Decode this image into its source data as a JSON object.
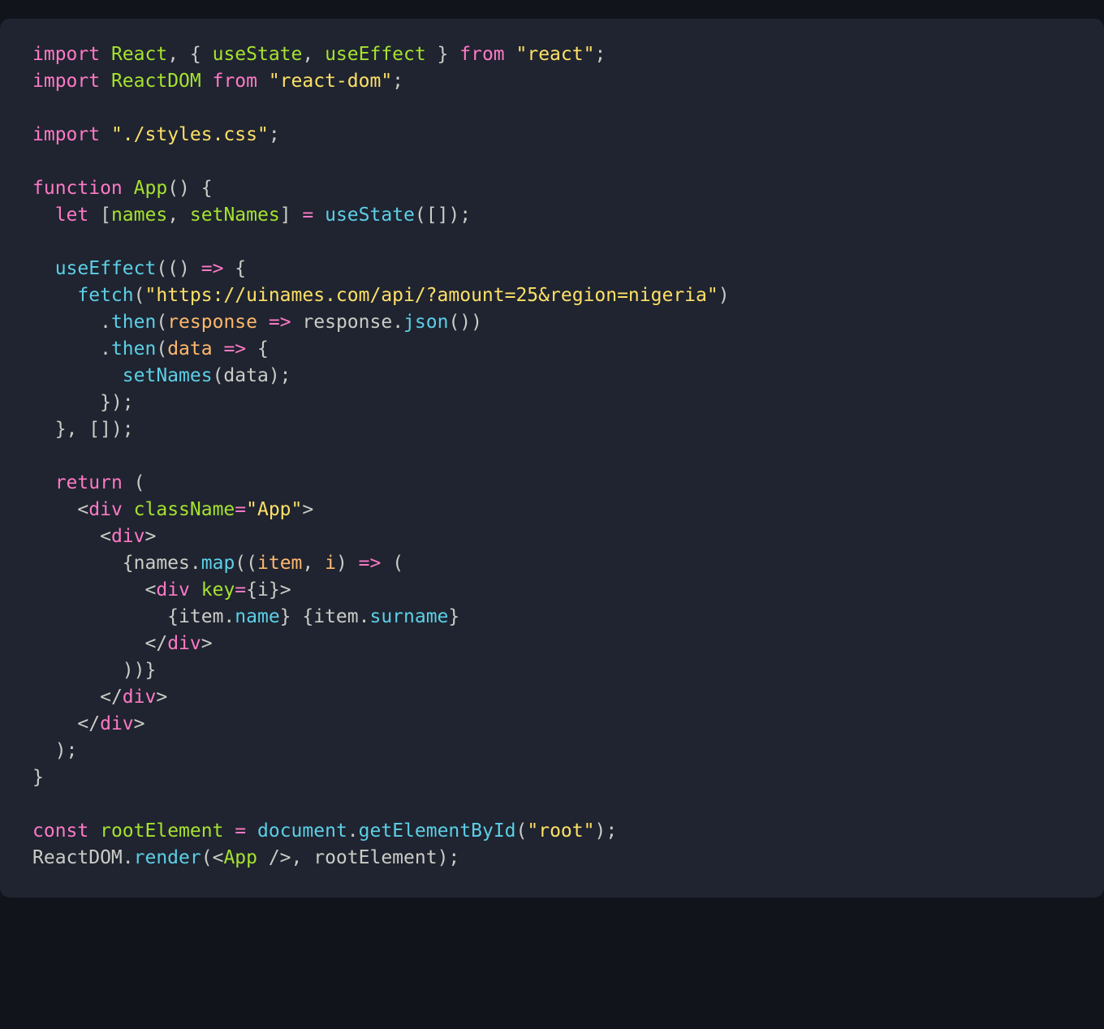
{
  "code": {
    "lines": [
      {
        "indent": 0,
        "tokens": [
          [
            "kw",
            "import"
          ],
          [
            "p",
            " "
          ],
          [
            "def",
            "React"
          ],
          [
            "p",
            ", { "
          ],
          [
            "def",
            "useState"
          ],
          [
            "p",
            ", "
          ],
          [
            "def",
            "useEffect"
          ],
          [
            "p",
            " } "
          ],
          [
            "kw",
            "from"
          ],
          [
            "p",
            " "
          ],
          [
            "str",
            "\"react\""
          ],
          [
            "p",
            ";"
          ]
        ]
      },
      {
        "indent": 0,
        "tokens": [
          [
            "kw",
            "import"
          ],
          [
            "p",
            " "
          ],
          [
            "def",
            "ReactDOM"
          ],
          [
            "p",
            " "
          ],
          [
            "kw",
            "from"
          ],
          [
            "p",
            " "
          ],
          [
            "str",
            "\"react-dom\""
          ],
          [
            "p",
            ";"
          ]
        ]
      },
      {
        "indent": 0,
        "tokens": []
      },
      {
        "indent": 0,
        "tokens": [
          [
            "kw",
            "import"
          ],
          [
            "p",
            " "
          ],
          [
            "str",
            "\"./styles.css\""
          ],
          [
            "p",
            ";"
          ]
        ]
      },
      {
        "indent": 0,
        "tokens": []
      },
      {
        "indent": 0,
        "tokens": [
          [
            "kw",
            "function"
          ],
          [
            "p",
            " "
          ],
          [
            "def",
            "App"
          ],
          [
            "p",
            "() {"
          ]
        ]
      },
      {
        "indent": 1,
        "tokens": [
          [
            "kw",
            "let"
          ],
          [
            "p",
            " ["
          ],
          [
            "def",
            "names"
          ],
          [
            "p",
            ", "
          ],
          [
            "def",
            "setNames"
          ],
          [
            "p",
            "] "
          ],
          [
            "op",
            "="
          ],
          [
            "p",
            " "
          ],
          [
            "fn",
            "useState"
          ],
          [
            "p",
            "([]);"
          ]
        ]
      },
      {
        "indent": 0,
        "tokens": []
      },
      {
        "indent": 1,
        "tokens": [
          [
            "fn",
            "useEffect"
          ],
          [
            "p",
            "(() "
          ],
          [
            "op",
            "=>"
          ],
          [
            "p",
            " {"
          ]
        ]
      },
      {
        "indent": 2,
        "tokens": [
          [
            "fn",
            "fetch"
          ],
          [
            "p",
            "("
          ],
          [
            "str",
            "\"https://uinames.com/api/?amount=25&region=nigeria\""
          ],
          [
            "p",
            ")"
          ]
        ]
      },
      {
        "indent": 3,
        "tokens": [
          [
            "p",
            "."
          ],
          [
            "fn",
            "then"
          ],
          [
            "p",
            "("
          ],
          [
            "par",
            "response"
          ],
          [
            "p",
            " "
          ],
          [
            "op",
            "=>"
          ],
          [
            "p",
            " "
          ],
          [
            "id",
            "response"
          ],
          [
            "p",
            "."
          ],
          [
            "fn",
            "json"
          ],
          [
            "p",
            "())"
          ]
        ]
      },
      {
        "indent": 3,
        "tokens": [
          [
            "p",
            "."
          ],
          [
            "fn",
            "then"
          ],
          [
            "p",
            "("
          ],
          [
            "par",
            "data"
          ],
          [
            "p",
            " "
          ],
          [
            "op",
            "=>"
          ],
          [
            "p",
            " {"
          ]
        ]
      },
      {
        "indent": 4,
        "tokens": [
          [
            "fn",
            "setNames"
          ],
          [
            "p",
            "("
          ],
          [
            "id",
            "data"
          ],
          [
            "p",
            ");"
          ]
        ]
      },
      {
        "indent": 3,
        "tokens": [
          [
            "p",
            "});"
          ]
        ]
      },
      {
        "indent": 1,
        "tokens": [
          [
            "p",
            "}, []);"
          ]
        ]
      },
      {
        "indent": 0,
        "tokens": []
      },
      {
        "indent": 1,
        "tokens": [
          [
            "kw",
            "return"
          ],
          [
            "p",
            " ("
          ]
        ]
      },
      {
        "indent": 2,
        "tokens": [
          [
            "p",
            "<"
          ],
          [
            "tag",
            "div"
          ],
          [
            "p",
            " "
          ],
          [
            "attr",
            "className"
          ],
          [
            "op",
            "="
          ],
          [
            "str",
            "\"App\""
          ],
          [
            "p",
            ">"
          ]
        ]
      },
      {
        "indent": 3,
        "tokens": [
          [
            "p",
            "<"
          ],
          [
            "tag",
            "div"
          ],
          [
            "p",
            ">"
          ]
        ]
      },
      {
        "indent": 4,
        "tokens": [
          [
            "p",
            "{"
          ],
          [
            "id",
            "names"
          ],
          [
            "p",
            "."
          ],
          [
            "fn",
            "map"
          ],
          [
            "p",
            "(("
          ],
          [
            "par",
            "item"
          ],
          [
            "p",
            ", "
          ],
          [
            "par",
            "i"
          ],
          [
            "p",
            ") "
          ],
          [
            "op",
            "=>"
          ],
          [
            "p",
            " ("
          ]
        ]
      },
      {
        "indent": 5,
        "tokens": [
          [
            "p",
            "<"
          ],
          [
            "tag",
            "div"
          ],
          [
            "p",
            " "
          ],
          [
            "attr",
            "key"
          ],
          [
            "op",
            "="
          ],
          [
            "p",
            "{"
          ],
          [
            "id",
            "i"
          ],
          [
            "p",
            "}>"
          ]
        ]
      },
      {
        "indent": 6,
        "tokens": [
          [
            "p",
            "{"
          ],
          [
            "id",
            "item"
          ],
          [
            "p",
            "."
          ],
          [
            "prop",
            "name"
          ],
          [
            "p",
            "} {"
          ],
          [
            "id",
            "item"
          ],
          [
            "p",
            "."
          ],
          [
            "prop",
            "surname"
          ],
          [
            "p",
            "}"
          ]
        ]
      },
      {
        "indent": 5,
        "tokens": [
          [
            "p",
            "</"
          ],
          [
            "tag",
            "div"
          ],
          [
            "p",
            ">"
          ]
        ]
      },
      {
        "indent": 4,
        "tokens": [
          [
            "p",
            "))}"
          ]
        ]
      },
      {
        "indent": 3,
        "tokens": [
          [
            "p",
            "</"
          ],
          [
            "tag",
            "div"
          ],
          [
            "p",
            ">"
          ]
        ]
      },
      {
        "indent": 2,
        "tokens": [
          [
            "p",
            "</"
          ],
          [
            "tag",
            "div"
          ],
          [
            "p",
            ">"
          ]
        ]
      },
      {
        "indent": 1,
        "tokens": [
          [
            "p",
            ");"
          ]
        ]
      },
      {
        "indent": 0,
        "tokens": [
          [
            "p",
            "}"
          ]
        ]
      },
      {
        "indent": 0,
        "tokens": []
      },
      {
        "indent": 0,
        "tokens": [
          [
            "kw",
            "const"
          ],
          [
            "p",
            " "
          ],
          [
            "def",
            "rootElement"
          ],
          [
            "p",
            " "
          ],
          [
            "op",
            "="
          ],
          [
            "p",
            " "
          ],
          [
            "const",
            "document"
          ],
          [
            "p",
            "."
          ],
          [
            "fn",
            "getElementById"
          ],
          [
            "p",
            "("
          ],
          [
            "str",
            "\"root\""
          ],
          [
            "p",
            ");"
          ]
        ]
      },
      {
        "indent": 0,
        "tokens": [
          [
            "id",
            "ReactDOM"
          ],
          [
            "p",
            "."
          ],
          [
            "fn",
            "render"
          ],
          [
            "p",
            "(<"
          ],
          [
            "def",
            "App"
          ],
          [
            "p",
            " />, "
          ],
          [
            "id",
            "rootElement"
          ],
          [
            "p",
            ");"
          ]
        ]
      }
    ],
    "indent_unit": "  "
  }
}
